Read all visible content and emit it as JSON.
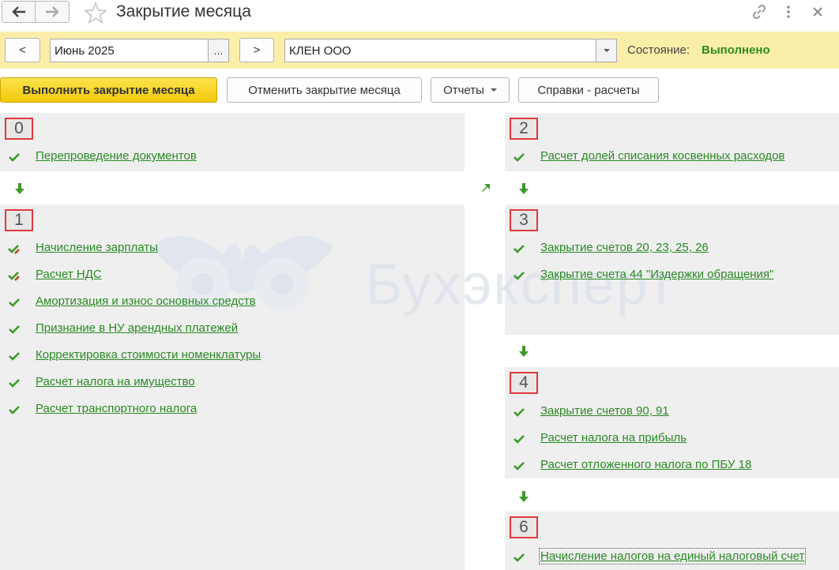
{
  "window": {
    "title": "Закрытие месяца",
    "back_icon": "arrow-left-icon",
    "forward_icon": "arrow-right-icon",
    "favorite_icon": "star-icon",
    "link_icon": "link-icon",
    "more_icon": "more-vertical-icon",
    "close_icon": "close-icon"
  },
  "toolbar": {
    "prev_label": "<",
    "next_label": ">",
    "period_value": "Июнь 2025",
    "period_select_label": "...",
    "org_value": "КЛЕН ООО",
    "state_label": "Состояние:",
    "state_value": "Выполнено"
  },
  "commands": {
    "run_label": "Выполнить закрытие месяца",
    "cancel_label": "Отменить закрытие месяца",
    "reports_label": "Отчеты",
    "references_label": "Справки - расчеты"
  },
  "colors": {
    "accent_yellow": "#fbeea9",
    "link_green": "#2a8a24",
    "badge_border": "#e0393e",
    "panel_bg": "#efefef"
  },
  "watermark": {
    "text": "Бухэксперт"
  },
  "steps": {
    "s0": {
      "number": "0",
      "items": [
        "Перепроведение документов"
      ]
    },
    "s1": {
      "number": "1",
      "items": [
        "Начисление зарплаты",
        "Расчет НДС",
        "Амортизация и износ основных средств",
        "Признание в НУ арендных платежей",
        "Корректировка стоимости номенклатуры",
        "Расчет налога на имущество",
        "Расчет транспортного налога"
      ]
    },
    "s2": {
      "number": "2",
      "items": [
        "Расчет долей списания косвенных расходов"
      ]
    },
    "s3": {
      "number": "3",
      "items": [
        "Закрытие счетов 20, 23, 25, 26",
        "Закрытие счета 44 \"Издержки обращения\""
      ]
    },
    "s4": {
      "number": "4",
      "items": [
        "Закрытие счетов 90, 91",
        "Расчет налога на прибыль",
        "Расчет отложенного налога по ПБУ 18"
      ]
    },
    "s6": {
      "number": "6",
      "items": [
        "Начисление налогов на единый налоговый счет"
      ]
    }
  }
}
